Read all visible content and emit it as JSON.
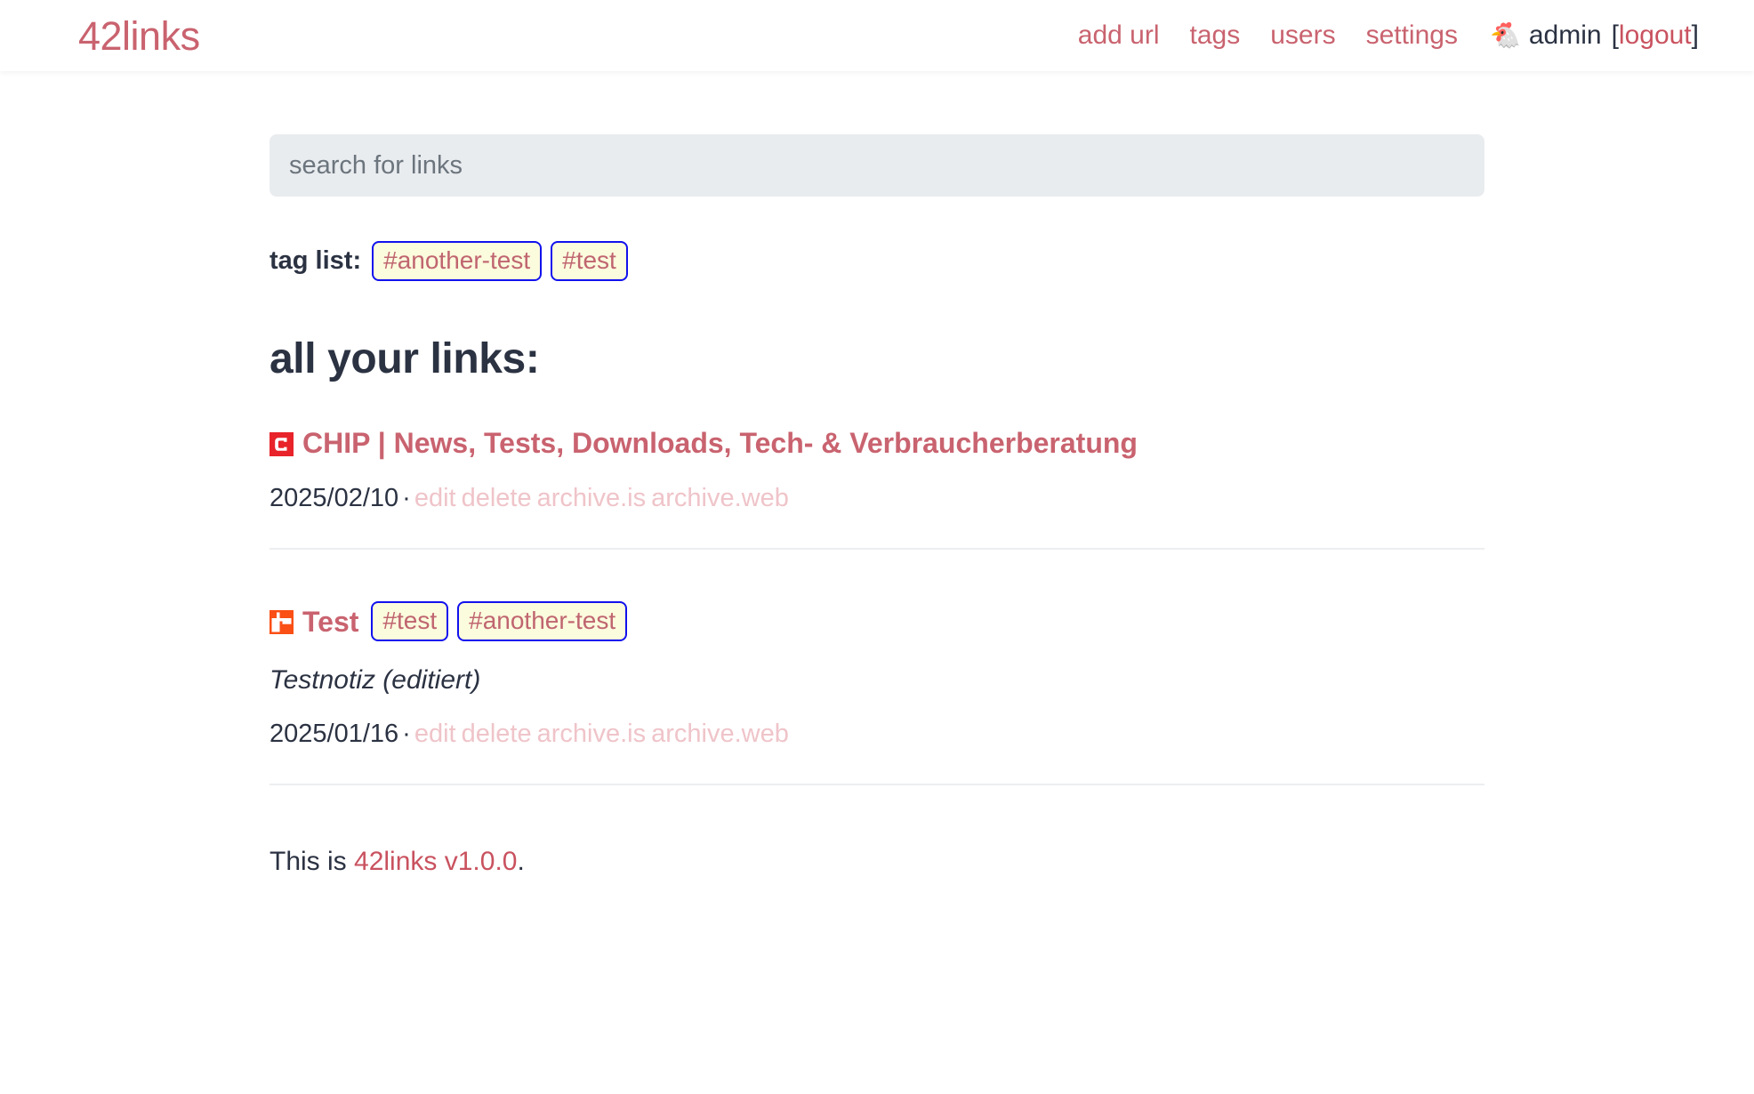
{
  "header": {
    "brand": "42links",
    "nav": [
      {
        "label": "add url",
        "name": "nav-add-url"
      },
      {
        "label": "tags",
        "name": "nav-tags"
      },
      {
        "label": "users",
        "name": "nav-users"
      },
      {
        "label": "settings",
        "name": "nav-settings"
      }
    ],
    "avatar_icon": "rooster-emoji",
    "avatar_glyph": "🐔",
    "username": "admin",
    "bracket_open": "[",
    "logout_label": "logout",
    "bracket_close": "]"
  },
  "search": {
    "placeholder": "search for links",
    "value": ""
  },
  "tag_list": {
    "label": "tag list:",
    "tags": [
      {
        "label": "#another-test"
      },
      {
        "label": "#test"
      }
    ]
  },
  "main": {
    "heading": "all your links:"
  },
  "links": [
    {
      "favicon_icon": "chip-favicon",
      "favicon_bg": "#e8232a",
      "title": "CHIP | News, Tests, Downloads, Tech- & Verbraucherberatung",
      "tags": [],
      "note": "",
      "date": "2025/02/10",
      "separator": "·",
      "actions": [
        {
          "label": "edit"
        },
        {
          "label": "delete"
        },
        {
          "label": "archive.is"
        },
        {
          "label": "archive.web"
        }
      ]
    },
    {
      "favicon_icon": "test-favicon",
      "favicon_bg": "#fa4f15",
      "title": "Test",
      "tags": [
        {
          "label": "#test"
        },
        {
          "label": "#another-test"
        }
      ],
      "note": "Testnotiz (editiert)",
      "date": "2025/01/16",
      "separator": "·",
      "actions": [
        {
          "label": "edit"
        },
        {
          "label": "delete"
        },
        {
          "label": "archive.is"
        },
        {
          "label": "archive.web"
        }
      ]
    }
  ],
  "footer": {
    "prefix": "This is ",
    "link_label": "42links v1.0.0",
    "suffix": "."
  },
  "colors": {
    "brand": "#c9636f",
    "link": "#c9525f",
    "text": "#2b3242",
    "muted_action": "#efc4c9",
    "tag_bg": "#fbfbdd",
    "tag_border": "#1111ee",
    "tag_text": "#c06570",
    "search_bg": "#e9ecef",
    "divider": "#eceef0"
  }
}
